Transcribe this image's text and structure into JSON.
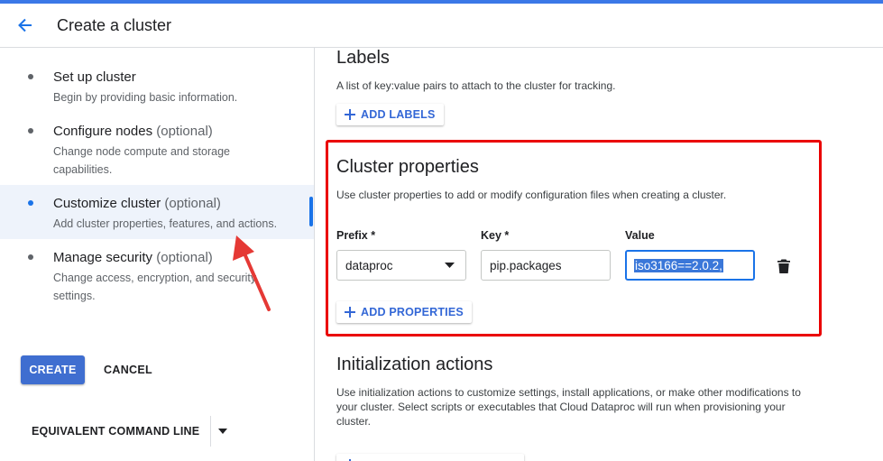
{
  "header": {
    "title": "Create a cluster"
  },
  "sidebar": {
    "steps": [
      {
        "title": "Set up cluster",
        "optional": "",
        "description": "Begin by providing basic information."
      },
      {
        "title": "Configure nodes",
        "optional": "(optional)",
        "description": "Change node compute and storage capabilities."
      },
      {
        "title": "Customize cluster",
        "optional": "(optional)",
        "description": "Add cluster properties, features, and actions."
      },
      {
        "title": "Manage security",
        "optional": "(optional)",
        "description": "Change access, encryption, and security settings."
      }
    ],
    "active_step": "Customize cluster"
  },
  "actions": {
    "create_label": "CREATE",
    "cancel_label": "CANCEL",
    "equivalent_label": "EQUIVALENT COMMAND LINE"
  },
  "labels_section": {
    "title": "Labels",
    "description": "A list of key:value pairs to attach to the cluster for tracking.",
    "add_label": "ADD LABELS"
  },
  "cluster_properties": {
    "title": "Cluster properties",
    "description": "Use cluster properties to add or modify configuration files when creating a cluster.",
    "prefix_label": "Prefix *",
    "key_label": "Key *",
    "value_label": "Value",
    "prefix_value": "dataproc",
    "key_value": "pip.packages",
    "value_value": "iso3166==2.0.2,",
    "add_label": "ADD PROPERTIES"
  },
  "init_actions": {
    "title": "Initialization actions",
    "description": "Use initialization actions to customize settings, install applications, or make other modifications to your cluster. Select scripts or executables that Cloud Dataproc will run when provisioning your cluster."
  },
  "colors": {
    "accent": "#1a73e8",
    "primary_button": "#3f6ed0",
    "highlight_box": "#ea0000",
    "annotation_arrow": "#e53935"
  },
  "icons": {
    "back": "arrow-left-icon",
    "add": "plus-icon",
    "dropdown": "caret-down-icon",
    "delete": "trash-icon"
  }
}
